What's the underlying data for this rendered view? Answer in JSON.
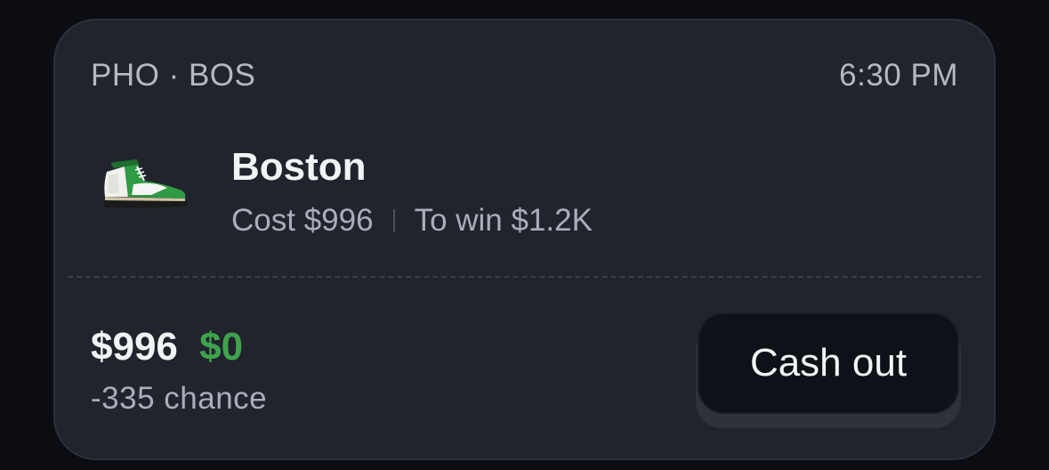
{
  "header": {
    "matchup": "PHO · BOS",
    "time": "6:30 PM"
  },
  "selection": {
    "team_icon": "green-sneaker-icon",
    "team": "Boston",
    "cost": "Cost $996",
    "to_win": "To win $1.2K"
  },
  "footer": {
    "current_value": "$996",
    "profit": "$0",
    "chance": "-335 chance",
    "cash_out_label": "Cash out"
  },
  "colors": {
    "background": "#0b0d12",
    "card": "#21242c",
    "profit_green": "#3fa34d",
    "button": "#0e1117"
  }
}
